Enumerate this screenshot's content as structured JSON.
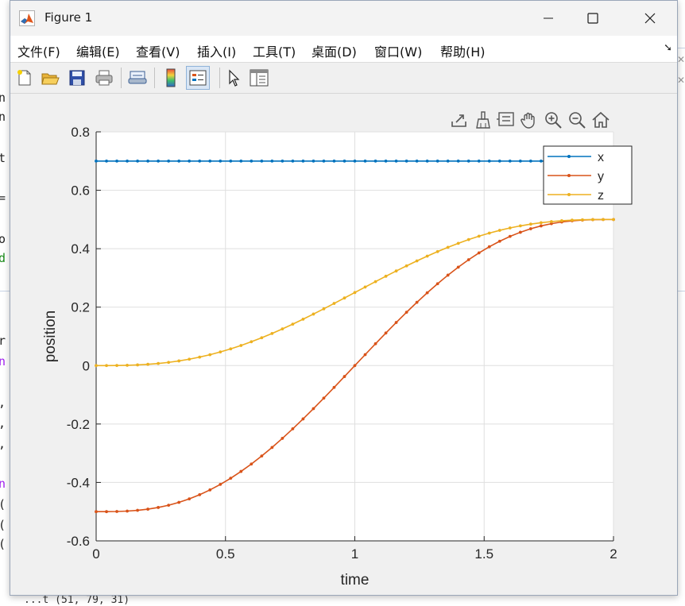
{
  "window": {
    "title": "Figure 1"
  },
  "menubar": {
    "items": [
      {
        "label": "文件(F)"
      },
      {
        "label": "编辑(E)"
      },
      {
        "label": "查看(V)"
      },
      {
        "label": "插入(I)"
      },
      {
        "label": "工具(T)"
      },
      {
        "label": "桌面(D)"
      },
      {
        "label": "窗口(W)"
      },
      {
        "label": "帮助(H)"
      }
    ]
  },
  "toolbar": {
    "buttons": [
      "new-figure-icon",
      "open-file-icon",
      "save-icon",
      "print-icon",
      "link-plot-icon",
      "colorbar-icon",
      "legend-icon",
      "pointer-icon",
      "property-inspector-icon"
    ],
    "active": "legend-icon"
  },
  "axes_toolbar": {
    "buttons": [
      "export-icon",
      "brush-icon",
      "data-tips-icon",
      "pan-icon",
      "zoom-in-icon",
      "zoom-out-icon",
      "home-icon"
    ]
  },
  "background": {
    "bottom_text": "...t (51, 79, 31)"
  },
  "chart_data": {
    "type": "line",
    "xlabel": "time",
    "ylabel": "position",
    "title": "",
    "xlim": [
      0,
      2
    ],
    "ylim": [
      -0.6,
      0.8
    ],
    "xticks": [
      "0",
      "0.5",
      "1",
      "1.5",
      "2"
    ],
    "yticks": [
      "-0.6",
      "-0.4",
      "-0.2",
      "0",
      "0.2",
      "0.4",
      "0.6",
      "0.8"
    ],
    "grid": true,
    "legend_position": "top-right",
    "markers": "dot",
    "samples": 51,
    "series": [
      {
        "name": "x",
        "color": "#0072BD",
        "start": 0.7,
        "end": 0.7
      },
      {
        "name": "y",
        "color": "#D95319",
        "start": -0.5,
        "end": 0.5
      },
      {
        "name": "z",
        "color": "#EDB120",
        "start": 0.0,
        "end": 0.5
      }
    ]
  }
}
